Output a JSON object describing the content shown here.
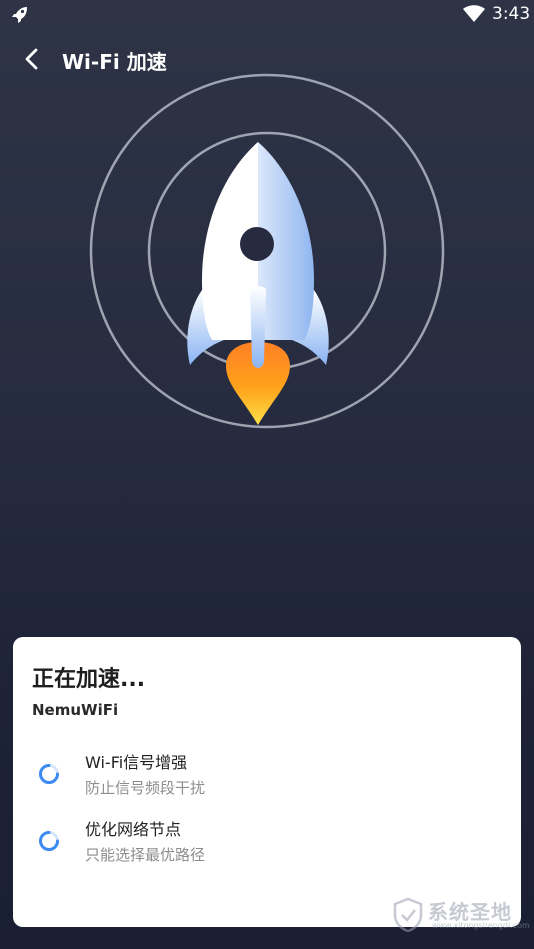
{
  "status_bar": {
    "time": "3:43",
    "left_icon": "rocket-icon",
    "wifi_icon": "wifi-icon"
  },
  "header": {
    "back_icon": "chevron-left-icon",
    "title": "Wi-Fi 加速"
  },
  "hero": {
    "rocket_icon": "rocket-icon",
    "ring_color": "#aab0c0",
    "rocket_color": "#e6eefb",
    "flame_color": "#ff9a1f"
  },
  "card": {
    "title": "正在加速...",
    "network_name": "NemuWiFi",
    "tasks": [
      {
        "title": "Wi-Fi信号增强",
        "description": "防止信号频段干扰",
        "status_icon": "loading-spinner-icon"
      },
      {
        "title": "优化网络节点",
        "description": "只能选择最优路径",
        "status_icon": "loading-spinner-icon"
      }
    ]
  },
  "watermark": {
    "text": "系统圣地",
    "url": "www.xitongshengdi.com"
  },
  "colors": {
    "background": "#262b3f",
    "accent": "#3d8bf2",
    "card": "#ffffff"
  }
}
